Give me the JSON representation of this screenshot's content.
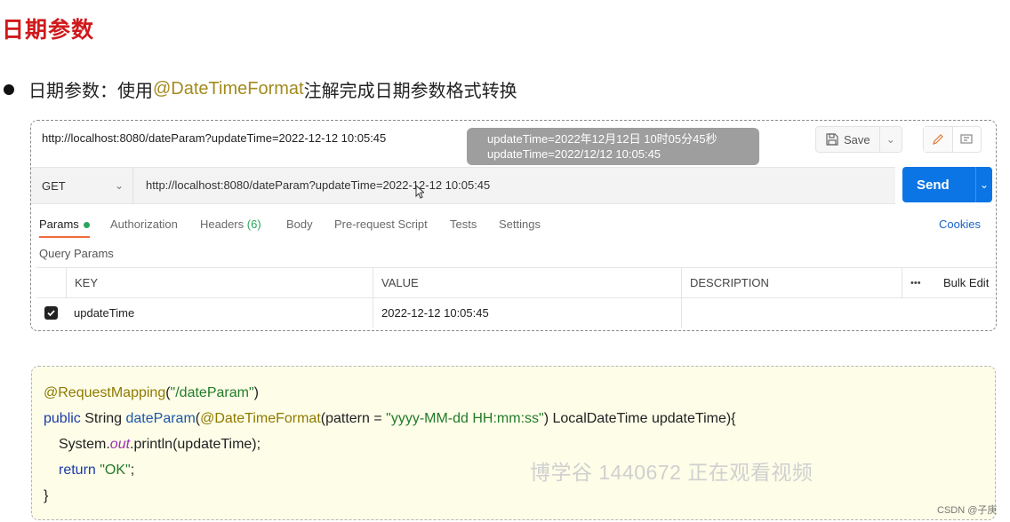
{
  "heading": "日期参数",
  "bullet": {
    "prefix": "日期参数：使用 ",
    "highlight": "@DateTimeFormat",
    "suffix": " 注解完成日期参数格式转换"
  },
  "postman": {
    "title_url": "http://localhost:8080/dateParam?updateTime=2022-12-12 10:05:45",
    "save_label": "Save",
    "method": "GET",
    "request_url": "http://localhost:8080/dateParam?updateTime=2022-12-12 10:05:45",
    "send_label": "Send",
    "tabs": {
      "params": "Params",
      "authorization": "Authorization",
      "headers": "Headers",
      "headers_count": "(6)",
      "body": "Body",
      "prerequest": "Pre-request Script",
      "tests": "Tests",
      "settings": "Settings"
    },
    "cookies": "Cookies",
    "query_params_label": "Query Params",
    "table": {
      "col_key": "KEY",
      "col_value": "VALUE",
      "col_description": "DESCRIPTION",
      "more": "•••",
      "bulk_edit": "Bulk Edit",
      "row_key": "updateTime",
      "row_value": "2022-12-12 10:05:45",
      "row_description": ""
    },
    "tooltip": {
      "line1": "updateTime=2022年12月12日 10时05分45秒",
      "line2": "updateTime=2022/12/12 10:05:45"
    }
  },
  "code": {
    "l1_ann": "@RequestMapping",
    "l1_open": "(",
    "l1_str": "\"/dateParam\"",
    "l1_close": ")",
    "l2_kw": "public",
    "l2_type": " String ",
    "l2_fn": "dateParam",
    "l2_open": "(",
    "l2_ann": "@DateTimeFormat",
    "l2_pattern": "(pattern = ",
    "l2_str": "\"yyyy-MM-dd HH:mm:ss\"",
    "l2_rest": ") LocalDateTime updateTime){",
    "l3_sys": "System.",
    "l3_out": "out",
    "l3_rest": ".println(updateTime);",
    "l4_kw": "return",
    "l4_sp": " ",
    "l4_str": "\"OK\"",
    "l4_end": ";",
    "l5": "}"
  },
  "watermark": "博学谷 1440672 正在观看视频",
  "csdn": "CSDN @子庚",
  "colors": {
    "accent_blue": "#0c75e5",
    "heading_red": "#d0191b",
    "annotation": "#8f7a00"
  }
}
